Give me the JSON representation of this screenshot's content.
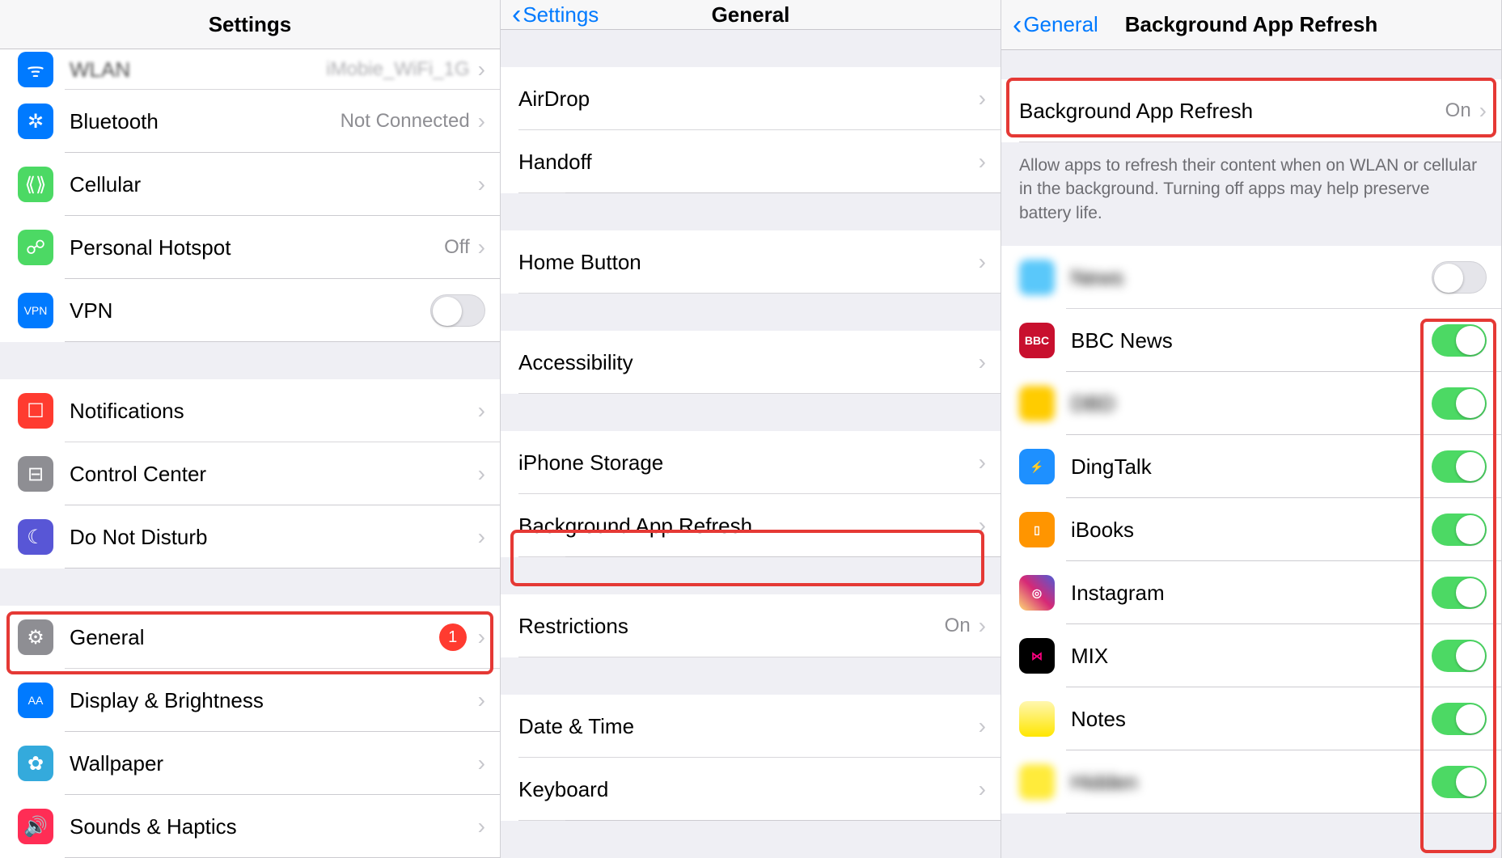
{
  "pane1": {
    "title": "Settings",
    "rows": [
      {
        "icon": "wifi-icon",
        "bg": "#007aff",
        "glyph": "ᯤ",
        "label": "WLAN",
        "detail": "iMobie_WiFi_1G",
        "cutoff": true
      },
      {
        "icon": "bluetooth-icon",
        "bg": "#007aff",
        "glyph": "✲",
        "label": "Bluetooth",
        "detail": "Not Connected"
      },
      {
        "icon": "cellular-icon",
        "bg": "#4cd964",
        "glyph": "⟪⟫",
        "label": "Cellular",
        "detail": ""
      },
      {
        "icon": "hotspot-icon",
        "bg": "#4cd964",
        "glyph": "☍",
        "label": "Personal Hotspot",
        "detail": "Off"
      },
      {
        "icon": "vpn-icon",
        "bg": "#007aff",
        "glyph": "VPN",
        "label": "VPN",
        "detail": "",
        "switch": "off",
        "small": true
      }
    ],
    "rows2": [
      {
        "icon": "notifications-icon",
        "bg": "#ff3b30",
        "glyph": "☐",
        "label": "Notifications"
      },
      {
        "icon": "control-center-icon",
        "bg": "#8e8e93",
        "glyph": "⊟",
        "label": "Control Center"
      },
      {
        "icon": "dnd-icon",
        "bg": "#5856d6",
        "glyph": "☾",
        "label": "Do Not Disturb"
      }
    ],
    "rows3": [
      {
        "icon": "general-icon",
        "bg": "#8e8e93",
        "glyph": "⚙",
        "label": "General",
        "badge": "1",
        "highlight": true
      },
      {
        "icon": "display-icon",
        "bg": "#007aff",
        "glyph": "AA",
        "label": "Display & Brightness",
        "small": true
      },
      {
        "icon": "wallpaper-icon",
        "bg": "#34aadc",
        "glyph": "✿",
        "label": "Wallpaper"
      },
      {
        "icon": "sounds-icon",
        "bg": "#ff2d55",
        "glyph": "🔊",
        "label": "Sounds & Haptics"
      }
    ]
  },
  "pane2": {
    "back": "Settings",
    "title": "General",
    "groups": [
      [
        {
          "label": "AirDrop"
        },
        {
          "label": "Handoff"
        }
      ],
      [
        {
          "label": "Home Button"
        }
      ],
      [
        {
          "label": "Accessibility"
        }
      ],
      [
        {
          "label": "iPhone Storage"
        },
        {
          "label": "Background App Refresh",
          "highlight": true
        }
      ],
      [
        {
          "label": "Restrictions",
          "detail": "On"
        }
      ],
      [
        {
          "label": "Date & Time"
        },
        {
          "label": "Keyboard"
        }
      ]
    ]
  },
  "pane3": {
    "back": "General",
    "title": "Background App Refresh",
    "master": {
      "label": "Background App Refresh",
      "detail": "On",
      "highlight": true
    },
    "footer": "Allow apps to refresh their content when on WLAN or cellular in the background. Turning off apps may help preserve battery life.",
    "apps": [
      {
        "label": "News",
        "bg": "#5ac8fa",
        "glyph": "",
        "switch": "off",
        "blur": true
      },
      {
        "label": "BBC News",
        "bg": "#c8102e",
        "glyph": "BBC",
        "switch": "on"
      },
      {
        "label": "DBD",
        "bg": "#ffcc00",
        "glyph": "",
        "switch": "on",
        "blur": true
      },
      {
        "label": "DingTalk",
        "bg": "#1e90ff",
        "glyph": "⚡",
        "switch": "on"
      },
      {
        "label": "iBooks",
        "bg": "#ff9500",
        "glyph": "▯",
        "switch": "on"
      },
      {
        "label": "Instagram",
        "bg": "linear-gradient(45deg,#feda75,#d62976,#4f5bd5)",
        "glyph": "◎",
        "switch": "on"
      },
      {
        "label": "MIX",
        "bg": "#000",
        "glyph": "⋈",
        "switch": "on",
        "color": "#ff0080"
      },
      {
        "label": "Notes",
        "bg": "linear-gradient(#fff7b0,#ffe600)",
        "glyph": "",
        "switch": "on"
      },
      {
        "label": "Hidden",
        "bg": "#ffeb3b",
        "glyph": "",
        "switch": "on",
        "blur": true
      }
    ],
    "toggles_highlight": true
  }
}
